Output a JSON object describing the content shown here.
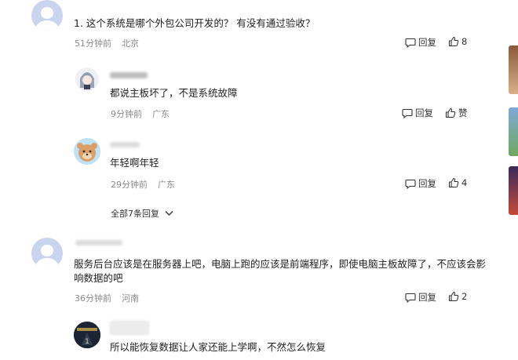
{
  "comments": [
    {
      "id": "c1",
      "text": "1. 这个系统是哪个外包公司开发的？ 有没有通过验收？",
      "time": "51分钟前",
      "location": "北京",
      "reply_label": "回复",
      "likes": "8",
      "replies": [
        {
          "id": "r1",
          "text": "都说主板坏了，不是系统故障",
          "time": "9分钟前",
          "location": "广东",
          "reply_label": "回复",
          "likes": "赞"
        },
        {
          "id": "r2",
          "text": "年轻啊年轻",
          "time": "29分钟前",
          "location": "广东",
          "reply_label": "回复",
          "likes": "4"
        }
      ],
      "expand_label": "全部7条回复"
    },
    {
      "id": "c2",
      "text_line1": "服务后台应该是在服务器上吧，电脑上跑的应该是前端程序，即使电脑主板故障了，不应该会影",
      "text_line2": "响数据的吧",
      "time": "36分钟前",
      "location": "河南",
      "reply_label": "回复",
      "likes": "2",
      "replies": [
        {
          "id": "r3",
          "text": "所以能恢复数据让人家还能上学啊，不然怎么恢复"
        }
      ]
    }
  ],
  "colors": {
    "meta_gray": "#8a8a8a",
    "avatar_default": "#c9d4ee"
  },
  "icons": [
    "comment-bubble-icon",
    "thumbs-up-icon",
    "chevron-down-icon",
    "default-avatar-icon"
  ]
}
